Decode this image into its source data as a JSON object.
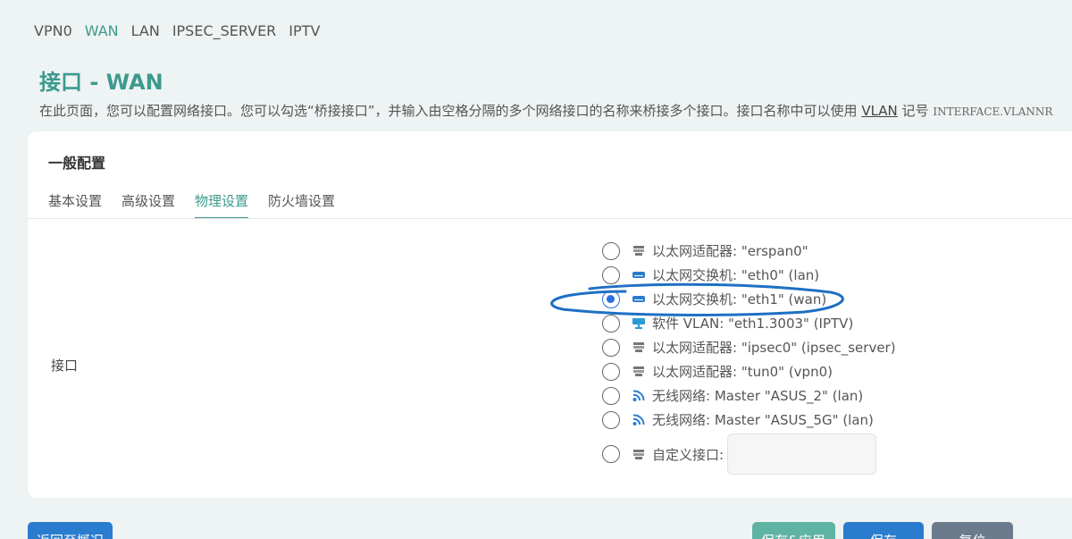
{
  "top_tabs": [
    "VPN0",
    "WAN",
    "LAN",
    "IPSEC_SERVER",
    "IPTV"
  ],
  "page": {
    "title": "接口 - WAN",
    "desc_before": "在此页面，您可以配置网络接口。您可以勾选“桥接接口”，并输入由空格分隔的多个网络接口的名称来桥接多个接口。接口名称中可以使用 ",
    "desc_vlan": "VLAN",
    "desc_after": " 记号 ",
    "desc_code": "INTERFACE.VLANNR"
  },
  "section": {
    "title": "一般配置",
    "tabs": [
      "基本设置",
      "高级设置",
      "物理设置",
      "防火墙设置"
    ],
    "active_tab": "物理设置"
  },
  "field": {
    "label": "接口",
    "options": [
      {
        "icon": "ethernet-adapter-icon",
        "label": "以太网适配器: \"erspan0\"",
        "checked": false
      },
      {
        "icon": "ethernet-switch-icon",
        "label": "以太网交换机: \"eth0\" (lan)",
        "checked": false
      },
      {
        "icon": "ethernet-switch-icon",
        "label": "以太网交换机: \"eth1\" (wan)",
        "checked": true
      },
      {
        "icon": "vlan-icon",
        "label": "软件 VLAN: \"eth1.3003\" (IPTV)",
        "checked": false
      },
      {
        "icon": "ethernet-adapter-icon",
        "label": "以太网适配器: \"ipsec0\" (ipsec_server)",
        "checked": false
      },
      {
        "icon": "ethernet-adapter-icon",
        "label": "以太网适配器: \"tun0\" (vpn0)",
        "checked": false
      },
      {
        "icon": "wifi-icon",
        "label": "无线网络: Master \"ASUS_2\" (lan)",
        "checked": false
      },
      {
        "icon": "wifi-icon",
        "label": "无线网络: Master \"ASUS_5G\" (lan)",
        "checked": false
      }
    ],
    "custom_label": "自定义接口:",
    "custom_value": ""
  },
  "buttons": {
    "back": "返回至概况",
    "save_apply": "保存&应用",
    "save": "保存",
    "reset": "复位"
  },
  "colors": {
    "accent": "#3c9a8e",
    "primary_button": "#2a7ccf",
    "annotation": "#1f6fc4"
  }
}
